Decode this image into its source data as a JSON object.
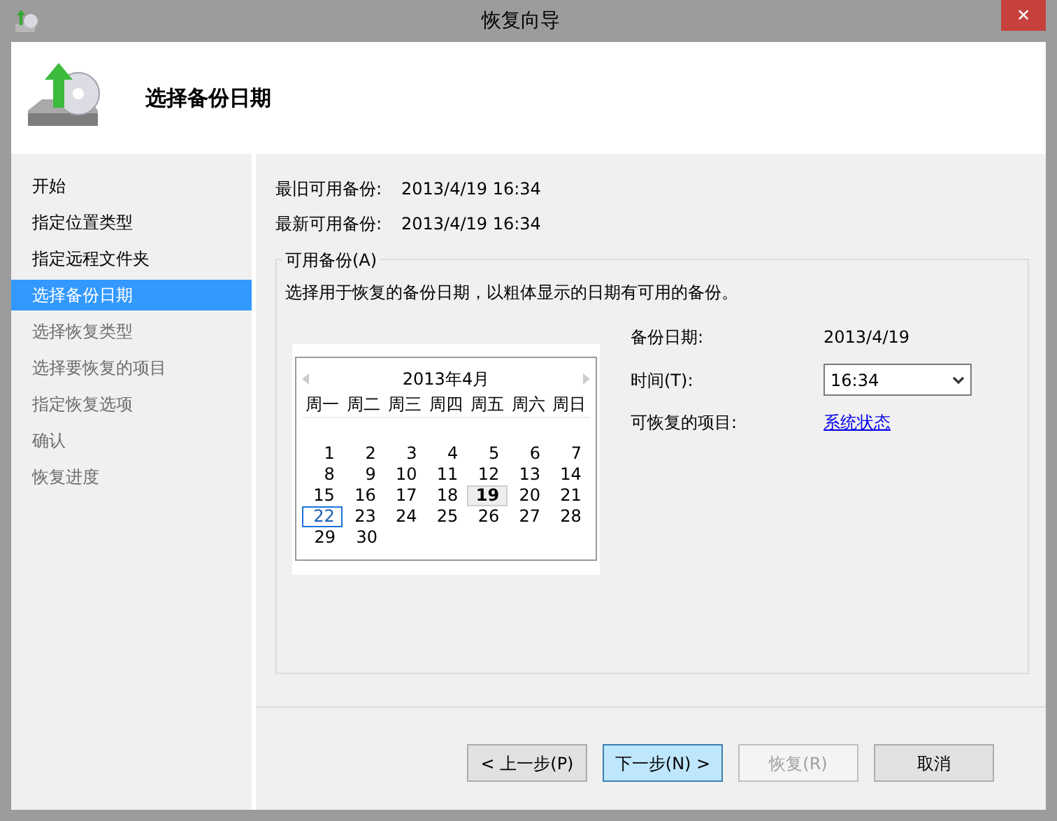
{
  "window": {
    "title": "恢复向导",
    "close": "✕"
  },
  "header": {
    "title": "选择备份日期"
  },
  "steps": [
    {
      "label": "开始",
      "selected": false,
      "disabled": false
    },
    {
      "label": "指定位置类型",
      "selected": false,
      "disabled": false
    },
    {
      "label": "指定远程文件夹",
      "selected": false,
      "disabled": false
    },
    {
      "label": "选择备份日期",
      "selected": true,
      "disabled": false
    },
    {
      "label": "选择恢复类型",
      "selected": false,
      "disabled": true
    },
    {
      "label": "选择要恢复的项目",
      "selected": false,
      "disabled": true
    },
    {
      "label": "指定恢复选项",
      "selected": false,
      "disabled": true
    },
    {
      "label": "确认",
      "selected": false,
      "disabled": true
    },
    {
      "label": "恢复进度",
      "selected": false,
      "disabled": true
    }
  ],
  "summary": [
    {
      "label": "最旧可用备份:",
      "value": "2013/4/19 16:34"
    },
    {
      "label": "最新可用备份:",
      "value": "2013/4/19 16:34"
    }
  ],
  "group": {
    "title": "可用备份(A)",
    "description": "选择用于恢复的备份日期，以粗体显示的日期有可用的备份。"
  },
  "calendar": {
    "month": "2013年4月",
    "weekdays": [
      "周一",
      "周二",
      "周三",
      "周四",
      "周五",
      "周六",
      "周日"
    ],
    "weeks": [
      [
        {
          "day": "1",
          "bold": false,
          "selected": false,
          "today": false
        },
        {
          "day": "2",
          "bold": false,
          "selected": false,
          "today": false
        },
        {
          "day": "3",
          "bold": false,
          "selected": false,
          "today": false
        },
        {
          "day": "4",
          "bold": false,
          "selected": false,
          "today": false
        },
        {
          "day": "5",
          "bold": false,
          "selected": false,
          "today": false
        },
        {
          "day": "6",
          "bold": false,
          "selected": false,
          "today": false
        },
        {
          "day": "7",
          "bold": false,
          "selected": false,
          "today": false
        }
      ],
      [
        {
          "day": "8",
          "bold": false,
          "selected": false,
          "today": false
        },
        {
          "day": "9",
          "bold": false,
          "selected": false,
          "today": false
        },
        {
          "day": "10",
          "bold": false,
          "selected": false,
          "today": false
        },
        {
          "day": "11",
          "bold": false,
          "selected": false,
          "today": false
        },
        {
          "day": "12",
          "bold": false,
          "selected": false,
          "today": false
        },
        {
          "day": "13",
          "bold": false,
          "selected": false,
          "today": false
        },
        {
          "day": "14",
          "bold": false,
          "selected": false,
          "today": false
        }
      ],
      [
        {
          "day": "15",
          "bold": false,
          "selected": false,
          "today": false
        },
        {
          "day": "16",
          "bold": false,
          "selected": false,
          "today": false
        },
        {
          "day": "17",
          "bold": false,
          "selected": false,
          "today": false
        },
        {
          "day": "18",
          "bold": false,
          "selected": false,
          "today": false
        },
        {
          "day": "19",
          "bold": true,
          "selected": true,
          "today": false
        },
        {
          "day": "20",
          "bold": false,
          "selected": false,
          "today": false
        },
        {
          "day": "21",
          "bold": false,
          "selected": false,
          "today": false
        }
      ],
      [
        {
          "day": "22",
          "bold": false,
          "selected": false,
          "today": true
        },
        {
          "day": "23",
          "bold": false,
          "selected": false,
          "today": false
        },
        {
          "day": "24",
          "bold": false,
          "selected": false,
          "today": false
        },
        {
          "day": "25",
          "bold": false,
          "selected": false,
          "today": false
        },
        {
          "day": "26",
          "bold": false,
          "selected": false,
          "today": false
        },
        {
          "day": "27",
          "bold": false,
          "selected": false,
          "today": false
        },
        {
          "day": "28",
          "bold": false,
          "selected": false,
          "today": false
        }
      ],
      [
        {
          "day": "29",
          "bold": false,
          "selected": false,
          "today": false
        },
        {
          "day": "30",
          "bold": false,
          "selected": false,
          "today": false
        }
      ]
    ]
  },
  "details": [
    {
      "kind": "text",
      "label": "备份日期:",
      "value": "2013/4/19"
    },
    {
      "kind": "dropdown",
      "label": "时间(T):",
      "value": "16:34"
    },
    {
      "kind": "link",
      "label": "可恢复的项目:",
      "value": "系统状态"
    }
  ],
  "buttons": [
    {
      "label": "< 上一步(P)",
      "default": false,
      "disabled": false
    },
    {
      "label": "下一步(N) >",
      "default": true,
      "disabled": false
    },
    {
      "label": "恢复(R)",
      "default": false,
      "disabled": true
    },
    {
      "label": "取消",
      "default": false,
      "disabled": false
    }
  ]
}
